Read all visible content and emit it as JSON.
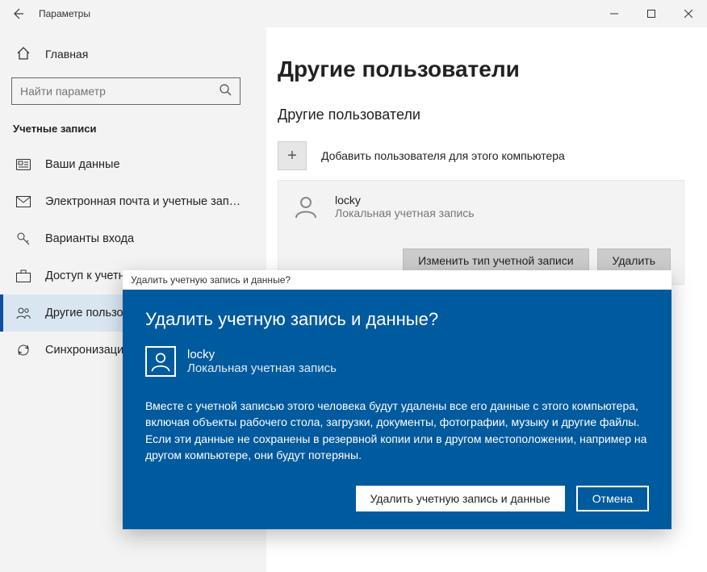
{
  "titlebar": {
    "title": "Параметры"
  },
  "sidebar": {
    "home": "Главная",
    "search_placeholder": "Найти параметр",
    "section": "Учетные записи",
    "items": [
      {
        "label": "Ваши данные"
      },
      {
        "label": "Электронная почта и учетные записи"
      },
      {
        "label": "Варианты входа"
      },
      {
        "label": "Доступ к учетной записи места работы или учебного заведения"
      },
      {
        "label": "Другие пользователи"
      },
      {
        "label": "Синхронизация ваших параметров"
      }
    ]
  },
  "main": {
    "h1": "Другие пользователи",
    "h2": "Другие пользователи",
    "add_label": "Добавить пользователя для этого компьютера",
    "user": {
      "name": "locky",
      "type": "Локальная учетная запись"
    },
    "change_btn": "Изменить тип учетной записи",
    "delete_btn": "Удалить"
  },
  "dialog": {
    "titlebar": "Удалить учетную запись и данные?",
    "heading": "Удалить учетную запись и данные?",
    "user": {
      "name": "locky",
      "type": "Локальная учетная запись"
    },
    "message": "Вместе с учетной записью этого человека будут удалены все его данные с этого компьютера, включая объекты рабочего стола, загрузки, документы, фотографии, музыку и другие файлы. Если эти данные не сохранены в резервной копии или в другом местоположении, например на другом компьютере, они будут потеряны.",
    "confirm_btn": "Удалить учетную запись и данные",
    "cancel_btn": "Отмена"
  }
}
